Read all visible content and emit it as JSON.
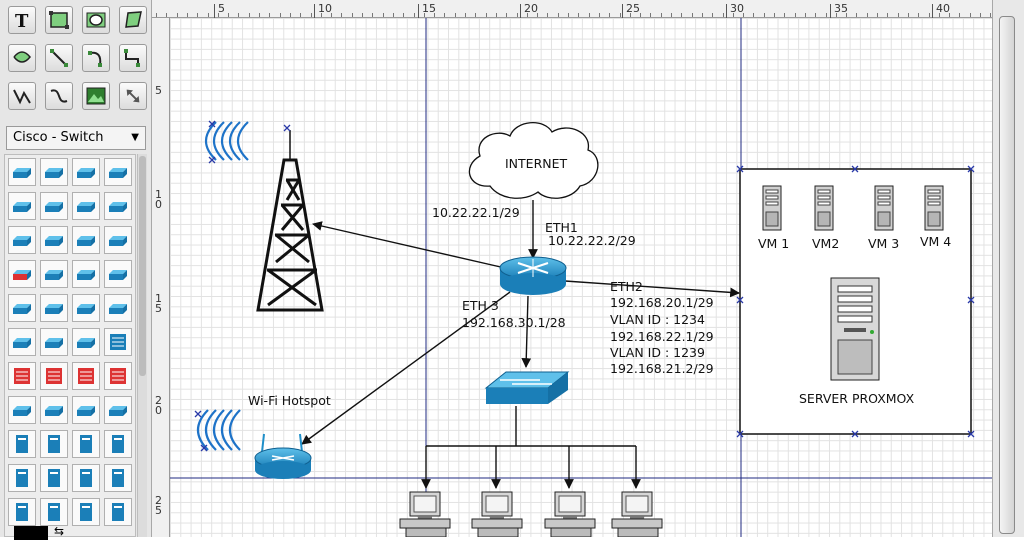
{
  "palette": {
    "tools": [
      "text-tool",
      "rectangle-tool",
      "ellipse-tool",
      "polygon-tool",
      "bezier-tool",
      "line-tool",
      "arc-tool",
      "zigzag-tool",
      "polyline-tool",
      "curve-tool",
      "image-tool",
      "move-tool"
    ],
    "shape_library": {
      "selected": "Cisco - Switch",
      "options": [
        "Cisco - Switch"
      ]
    },
    "shapes": [
      "switch",
      "switch",
      "switch",
      "switch",
      "switch",
      "switch",
      "switch",
      "switch",
      "switch",
      "switch",
      "switch",
      "switch",
      "router",
      "switch",
      "switch",
      "atm-switch",
      "switch",
      "switch",
      "switch",
      "switch",
      "switch",
      "switch",
      "switch",
      "switch",
      "switch",
      "switch",
      "switch",
      "switch",
      "switch",
      "switch",
      "switch",
      "switch",
      "switch",
      "switch",
      "switch",
      "switch",
      "switch",
      "switch",
      "switch",
      "switch",
      "switch",
      "switch",
      "switch",
      "switch"
    ]
  },
  "ruler": {
    "top": [
      "5",
      "10",
      "15",
      "20",
      "25",
      "30",
      "35",
      "40"
    ],
    "left": [
      "5",
      "1 0",
      "1 5",
      "2 0",
      "2 5"
    ]
  },
  "diagram": {
    "cloud_label": "INTERNET",
    "uplink_ip": "10.22.22.1/29",
    "eth1": {
      "name": "ETH1",
      "ip": "10.22.22.2/29"
    },
    "eth3": {
      "name": "ETH 3",
      "ip": "192.168.30.1/28"
    },
    "eth2": {
      "name": "ETH2",
      "lines": [
        "192.168.20.1/29",
        "VLAN ID : 1234",
        "192.168.22.1/29",
        "VLAN ID : 1239",
        "192.168.21.2/29"
      ]
    },
    "hotspot_label": "Wi-Fi Hotspot",
    "server_label": "SERVER PROXMOX",
    "vms": [
      "VM 1",
      "VM2",
      "VM 3",
      "VM 4"
    ]
  },
  "colors": {
    "router": "#1f8fc9",
    "switch": "#1f8fc9",
    "wifi_waves": "#1e73c8",
    "guide_line": "#1f2a80",
    "selection_handle": "#2a3aa8"
  }
}
